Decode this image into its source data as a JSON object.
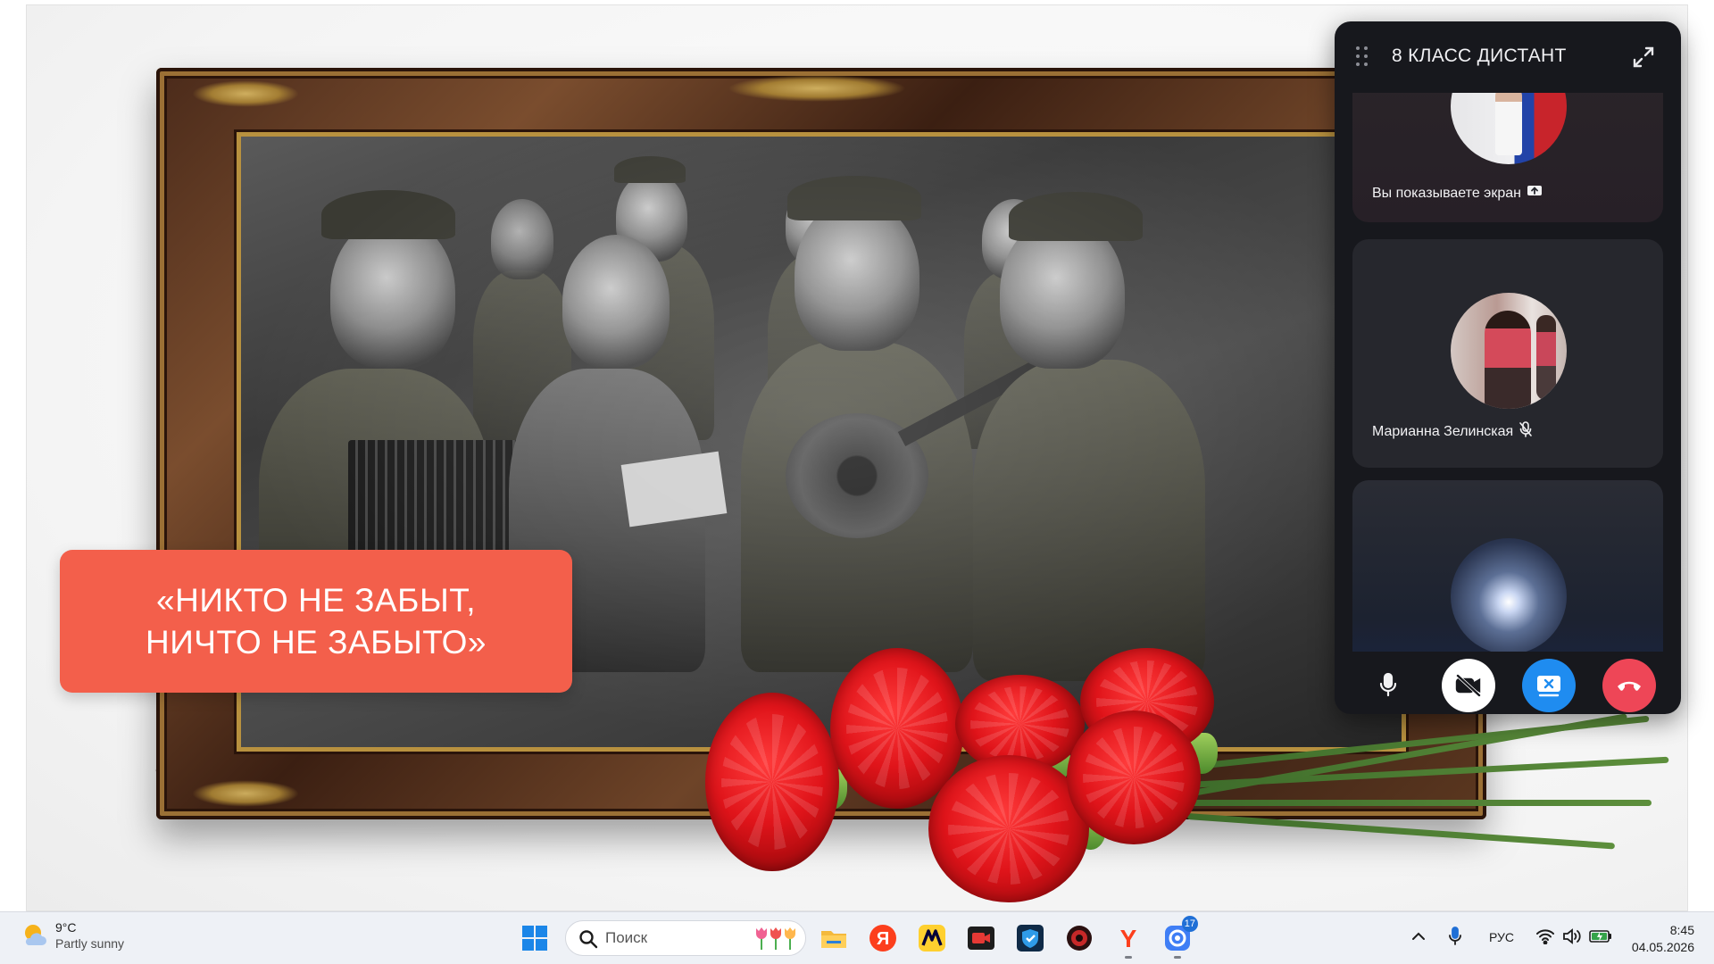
{
  "slide": {
    "quote_line1": "«НИКТО НЕ ЗАБЫТ,",
    "quote_line2": "НИЧТО НЕ ЗАБЫТО»"
  },
  "call_panel": {
    "title": "8 КЛАСС ДИСТАНТ",
    "participants": [
      {
        "label": "Вы показываете экран"
      },
      {
        "label": "Марианна Зелинская"
      },
      {
        "label": ""
      }
    ],
    "accent_share": "#1f8cf0",
    "accent_end": "#ee4657"
  },
  "taskbar": {
    "weather_temp": "9°C",
    "weather_desc": "Partly sunny",
    "search_placeholder": "Поиск",
    "language": "РУС",
    "time": "8:45",
    "date": "04.05.2026",
    "badge_count": "17"
  },
  "colors": {
    "quote_card": "#f35f4b",
    "panel_bg": "#17181d"
  }
}
